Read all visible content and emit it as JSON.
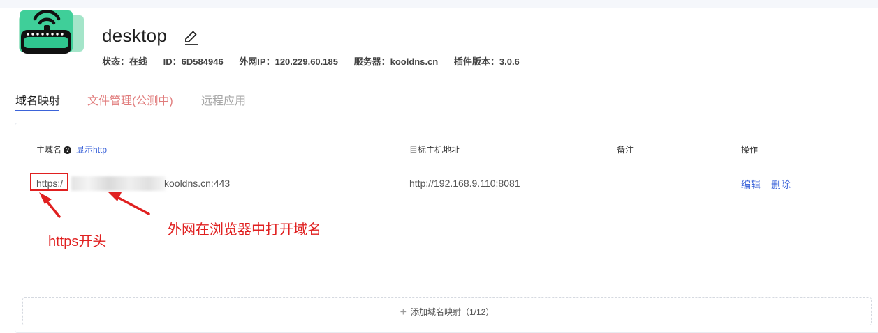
{
  "header": {
    "title": "desktop",
    "meta": [
      {
        "label": "状态：",
        "value": "在线"
      },
      {
        "label": "ID：",
        "value": "6D584946"
      },
      {
        "label": "外网IP：",
        "value": "120.229.60.185"
      },
      {
        "label": "服务器：",
        "value": "kooldns.cn"
      },
      {
        "label": "插件版本：",
        "value": "3.0.6"
      }
    ]
  },
  "tabs": {
    "domain_mapping": "域名映射",
    "file_manager": "文件管理(公测中)",
    "remote_app": "远程应用"
  },
  "table": {
    "col_domain": "主域名",
    "show_http": "显示http",
    "col_target": "目标主机地址",
    "col_note": "备注",
    "col_action": "操作",
    "rows": [
      {
        "domain_prefix": "https:/",
        "domain_suffix": "kooldns.cn:443",
        "target": "http://192.168.9.110:8081",
        "note": "",
        "edit": "编辑",
        "delete": "删除"
      }
    ]
  },
  "annotations": {
    "https_start": "https开头",
    "open_in_browser": "外网在浏览器中打开域名"
  },
  "add_mapping": {
    "plus": "+",
    "label": "添加域名映射（1/12）"
  },
  "colors": {
    "accent": "#3b63d9",
    "annotation_red": "#e02020",
    "tab_files": "#e07b7b",
    "logo_green": "#4fd3a0"
  }
}
